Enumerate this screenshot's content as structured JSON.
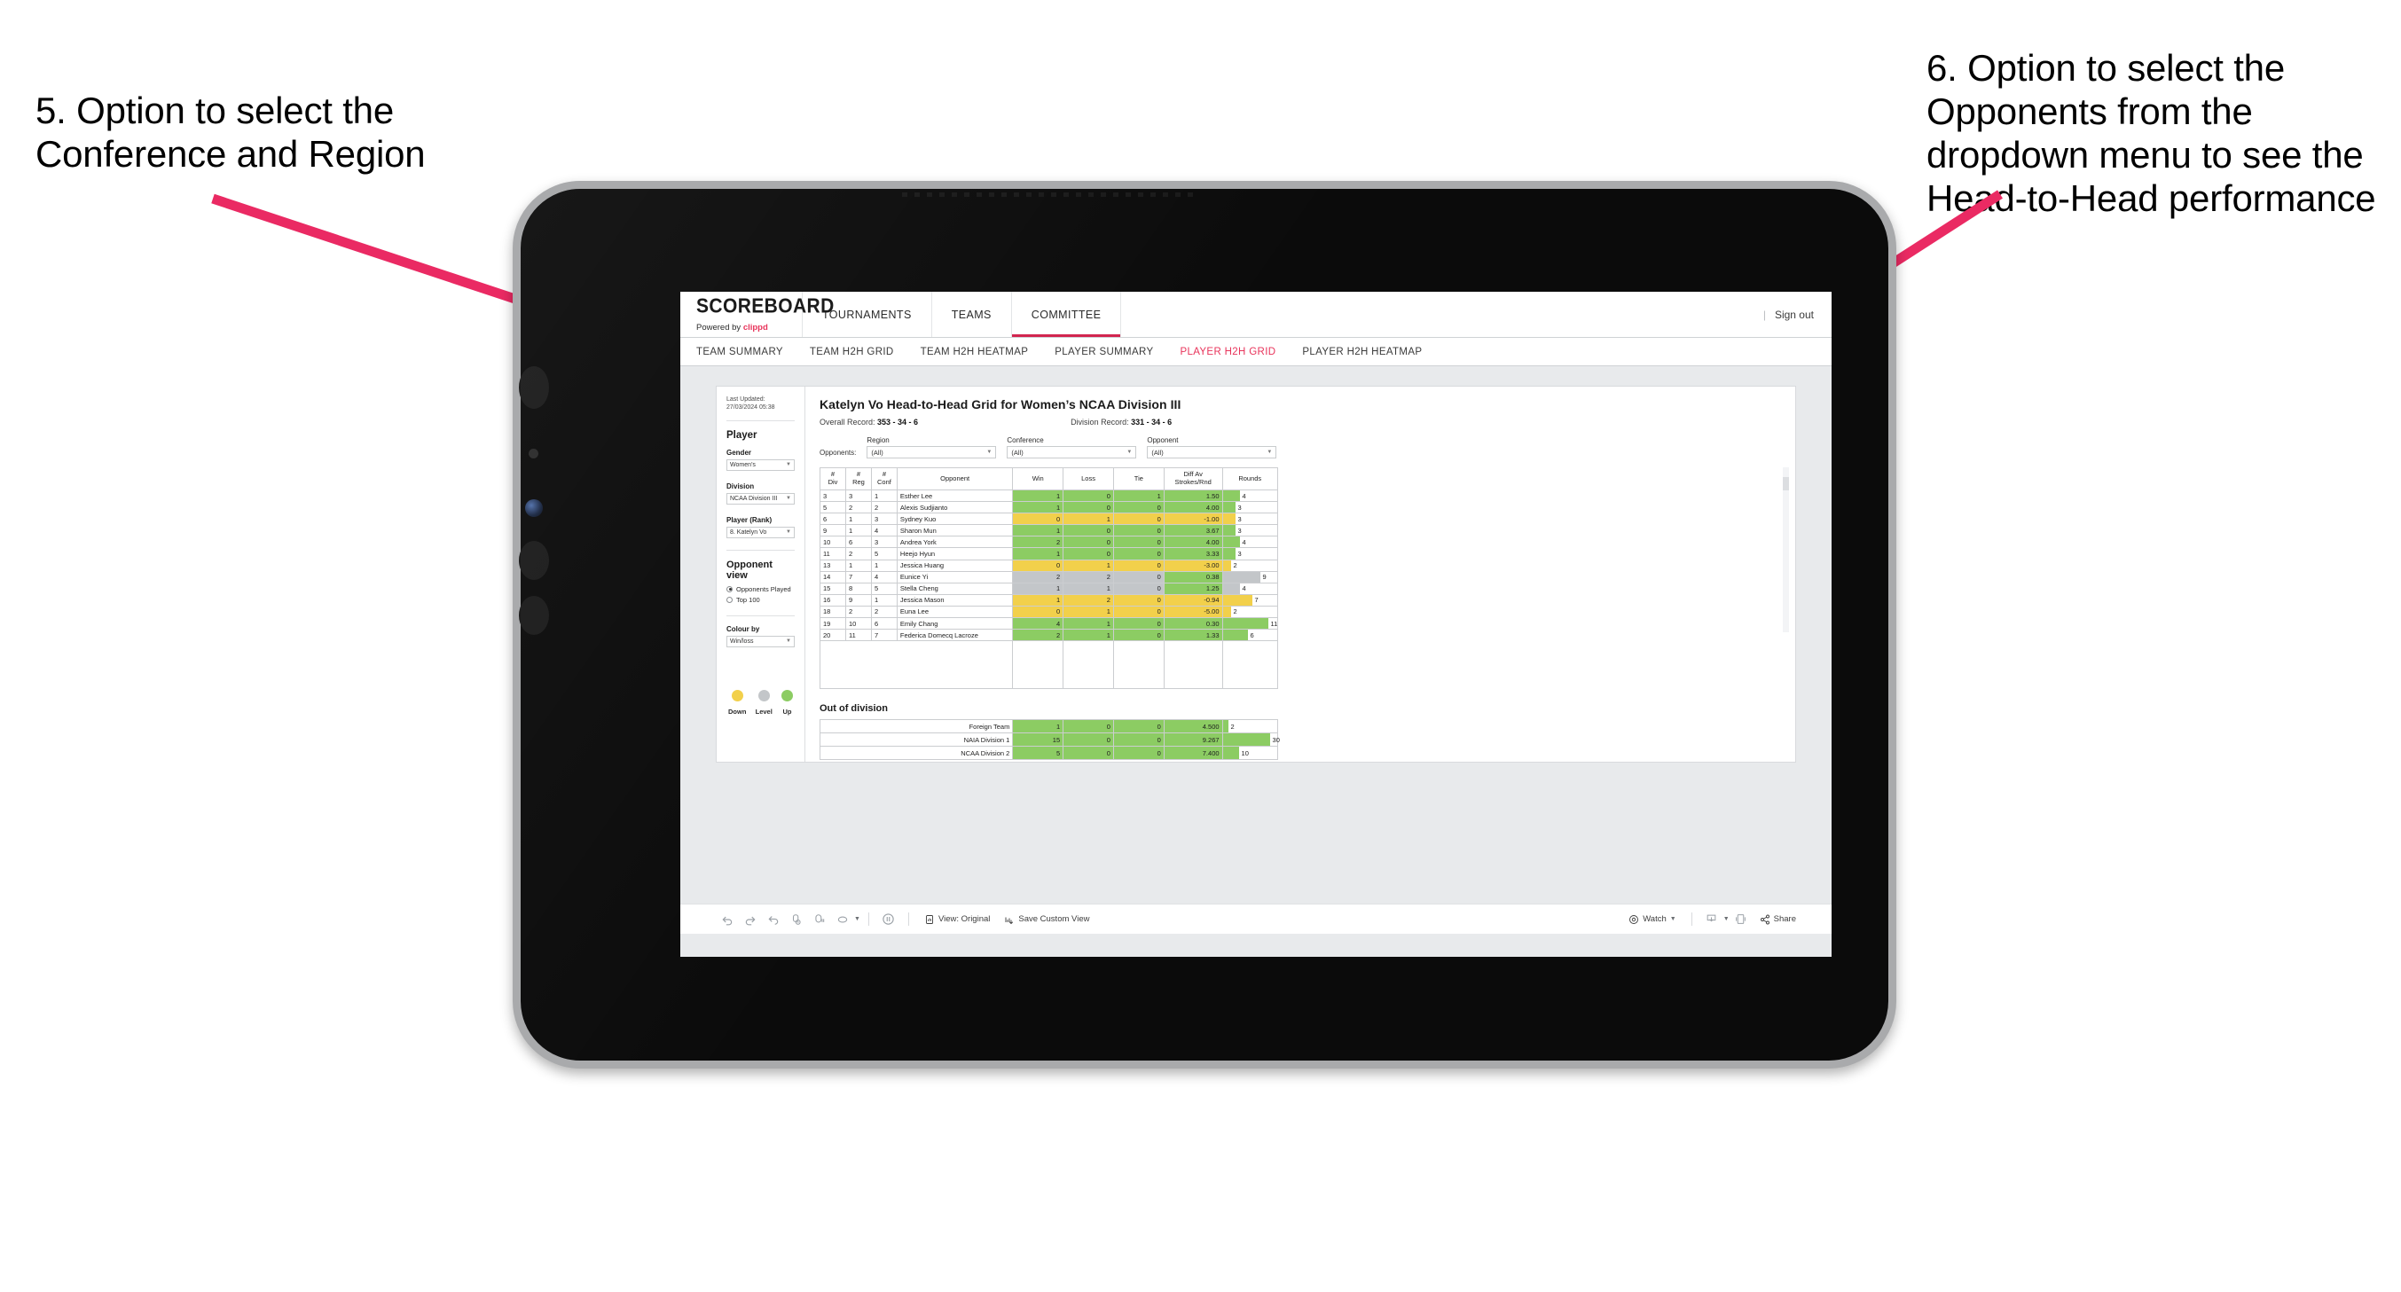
{
  "annotations": {
    "left": "5. Option to select the Conference and Region",
    "right": "6. Option to select the Opponents from the dropdown menu to see the Head-to-Head performance"
  },
  "app": {
    "brand": {
      "name": "SCOREBOARD",
      "powered_prefix": "Powered by ",
      "powered_brand": "clippd"
    },
    "top_nav": [
      {
        "label": "TOURNAMENTS",
        "active": false
      },
      {
        "label": "TEAMS",
        "active": false
      },
      {
        "label": "COMMITTEE",
        "active": true
      }
    ],
    "header_right": {
      "divider": "|",
      "sign_out": "Sign out"
    },
    "sub_nav": [
      {
        "label": "TEAM SUMMARY",
        "active": false
      },
      {
        "label": "TEAM H2H GRID",
        "active": false
      },
      {
        "label": "TEAM H2H HEATMAP",
        "active": false
      },
      {
        "label": "PLAYER SUMMARY",
        "active": false
      },
      {
        "label": "PLAYER H2H GRID",
        "active": true
      },
      {
        "label": "PLAYER H2H HEATMAP",
        "active": false
      }
    ]
  },
  "sidebar": {
    "last_updated": "Last Updated: 27/03/2024 05:38",
    "player_heading": "Player",
    "gender_label": "Gender",
    "gender_value": "Women’s",
    "division_label": "Division",
    "division_value": "NCAA Division III",
    "player_rank_label": "Player (Rank)",
    "player_rank_value": "8. Katelyn Vo",
    "opponent_view_heading": "Opponent view",
    "opponent_view_options": [
      {
        "label": "Opponents Played",
        "selected": true
      },
      {
        "label": "Top 100",
        "selected": false
      }
    ],
    "colour_by_label": "Colour by",
    "colour_by_value": "Win/loss",
    "legend": [
      {
        "label": "Down",
        "color": "#f2d04b"
      },
      {
        "label": "Level",
        "color": "#c3c6c9"
      },
      {
        "label": "Up",
        "color": "#8ccc63"
      }
    ]
  },
  "main": {
    "title": "Katelyn Vo Head-to-Head Grid for Women’s NCAA Division III",
    "overall_record_label": "Overall Record: ",
    "overall_record_value": "353 -  34 - 6",
    "division_record_label": "Division Record: ",
    "division_record_value": "331 -  34 - 6",
    "filters_lead": "Opponents:",
    "filters": [
      {
        "label": "Region",
        "value": "(All)"
      },
      {
        "label": "Conference",
        "value": "(All)"
      },
      {
        "label": "Opponent",
        "value": "(All)"
      }
    ],
    "out_of_division_title": "Out of division"
  },
  "chart_data": {
    "type": "table",
    "title": "Katelyn Vo Head-to-Head Grid for Women’s NCAA Division III",
    "columns": [
      "# Div",
      "# Reg",
      "# Conf",
      "Opponent",
      "Win",
      "Loss",
      "Tie",
      "Diff Av Strokes/Rnd",
      "Rounds"
    ],
    "column_headers_multiline": [
      [
        "#",
        "Div"
      ],
      [
        "#",
        "Reg"
      ],
      [
        "#",
        "Conf"
      ],
      [
        "Opponent"
      ],
      [
        "Win"
      ],
      [
        "Loss"
      ],
      [
        "Tie"
      ],
      [
        "Diff Av",
        "Strokes/Rnd"
      ],
      [
        "Rounds"
      ]
    ],
    "rounds_axis_max": 12,
    "rows": [
      {
        "div": "3",
        "reg": "3",
        "conf": "1",
        "opponent": "Esther Lee",
        "win": "1",
        "loss": "0",
        "tie": "1",
        "diff": "1.50",
        "rounds": 4,
        "color": "#8ccc63"
      },
      {
        "div": "5",
        "reg": "2",
        "conf": "2",
        "opponent": "Alexis Sudjianto",
        "win": "1",
        "loss": "0",
        "tie": "0",
        "diff": "4.00",
        "rounds": 3,
        "color": "#8ccc63"
      },
      {
        "div": "6",
        "reg": "1",
        "conf": "3",
        "opponent": "Sydney Kuo",
        "win": "0",
        "loss": "1",
        "tie": "0",
        "diff": "-1.00",
        "rounds": 3,
        "color": "#f2d04b"
      },
      {
        "div": "9",
        "reg": "1",
        "conf": "4",
        "opponent": "Sharon Mun",
        "win": "1",
        "loss": "0",
        "tie": "0",
        "diff": "3.67",
        "rounds": 3,
        "color": "#8ccc63"
      },
      {
        "div": "10",
        "reg": "6",
        "conf": "3",
        "opponent": "Andrea York",
        "win": "2",
        "loss": "0",
        "tie": "0",
        "diff": "4.00",
        "rounds": 4,
        "color": "#8ccc63"
      },
      {
        "div": "11",
        "reg": "2",
        "conf": "5",
        "opponent": "Heejo Hyun",
        "win": "1",
        "loss": "0",
        "tie": "0",
        "diff": "3.33",
        "rounds": 3,
        "color": "#8ccc63"
      },
      {
        "div": "13",
        "reg": "1",
        "conf": "1",
        "opponent": "Jessica Huang",
        "win": "0",
        "loss": "1",
        "tie": "0",
        "diff": "-3.00",
        "rounds": 2,
        "color": "#f2d04b"
      },
      {
        "div": "14",
        "reg": "7",
        "conf": "4",
        "opponent": "Eunice Yi",
        "win": "2",
        "loss": "2",
        "tie": "0",
        "diff": "0.38",
        "rounds": 9,
        "color": "#c3c6c9",
        "diff_color": "#8ccc63"
      },
      {
        "div": "15",
        "reg": "8",
        "conf": "5",
        "opponent": "Stella Cheng",
        "win": "1",
        "loss": "1",
        "tie": "0",
        "diff": "1.25",
        "rounds": 4,
        "color": "#c3c6c9",
        "diff_color": "#8ccc63"
      },
      {
        "div": "16",
        "reg": "9",
        "conf": "1",
        "opponent": "Jessica Mason",
        "win": "1",
        "loss": "2",
        "tie": "0",
        "diff": "-0.94",
        "rounds": 7,
        "color": "#f2d04b"
      },
      {
        "div": "18",
        "reg": "2",
        "conf": "2",
        "opponent": "Euna Lee",
        "win": "0",
        "loss": "1",
        "tie": "0",
        "diff": "-5.00",
        "rounds": 2,
        "color": "#f2d04b"
      },
      {
        "div": "19",
        "reg": "10",
        "conf": "6",
        "opponent": "Emily Chang",
        "win": "4",
        "loss": "1",
        "tie": "0",
        "diff": "0.30",
        "rounds": 11,
        "color": "#8ccc63"
      },
      {
        "div": "20",
        "reg": "11",
        "conf": "7",
        "opponent": "Federica Domecq Lacroze",
        "win": "2",
        "loss": "1",
        "tie": "0",
        "diff": "1.33",
        "rounds": 6,
        "color": "#8ccc63"
      }
    ],
    "out_of_division": {
      "rounds_axis_max": 32,
      "rows": [
        {
          "name": "Foreign Team",
          "win": "1",
          "loss": "0",
          "tie": "0",
          "diff": "4.500",
          "rounds": 2,
          "color": "#8ccc63"
        },
        {
          "name": "NAIA Division 1",
          "win": "15",
          "loss": "0",
          "tie": "0",
          "diff": "9.267",
          "rounds": 30,
          "color": "#8ccc63"
        },
        {
          "name": "NCAA Division 2",
          "win": "5",
          "loss": "0",
          "tie": "0",
          "diff": "7.400",
          "rounds": 10,
          "color": "#8ccc63"
        }
      ]
    }
  },
  "toolbar": {
    "icons": [
      "undo-icon",
      "redo-icon",
      "revert-icon",
      "refresh-data-icon",
      "pause-updates-icon",
      "rewind-icon"
    ],
    "view_label": "View: Original",
    "save_custom_view_label": "Save Custom View",
    "watch_label": "Watch",
    "share_label": "Share"
  }
}
